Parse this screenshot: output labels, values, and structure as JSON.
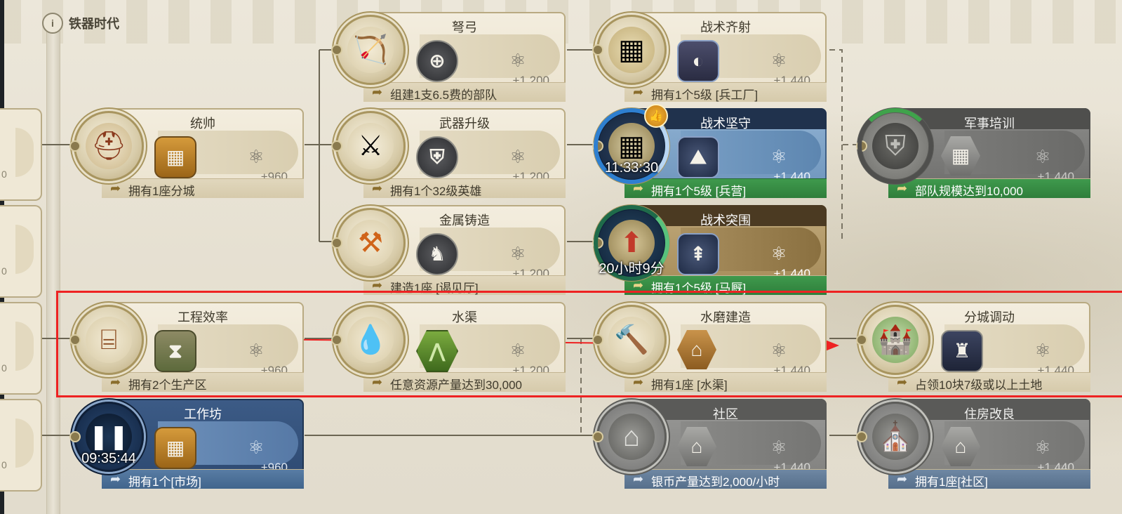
{
  "era": {
    "title": "铁器时代",
    "icon": "info-icon"
  },
  "cards": [
    {
      "id": "crossbow",
      "title": "弩弓",
      "bonus": "helmet-icon",
      "cost": "+1,200",
      "req": "组建1支6.5费的部队",
      "art": "crossbow-icon",
      "state": "normal"
    },
    {
      "id": "volley",
      "title": "战术齐射",
      "bonus": "helmet-icon",
      "cost": "+1,440",
      "req": "拥有1个5级 [兵工厂]",
      "art": "formation-icon",
      "state": "normal"
    },
    {
      "id": "commander",
      "title": "统帅",
      "bonus": "building-icon",
      "cost": "+960",
      "req": "拥有1座分城",
      "art": "helmet-icon",
      "state": "normal"
    },
    {
      "id": "weapon",
      "title": "武器升级",
      "bonus": "shield-icon",
      "cost": "+1,200",
      "req": "拥有1个32级英雄",
      "art": "saber-icon",
      "state": "normal"
    },
    {
      "id": "hold",
      "title": "战术坚守",
      "bonus": "defense-icon",
      "cost": "+1,440",
      "req": "拥有1个5级 [兵营]",
      "art": "formation-icon",
      "state": "researching",
      "timer": "11:33:30"
    },
    {
      "id": "drill",
      "title": "军事培训",
      "bonus": "building-icon",
      "cost": "+1,440",
      "req": "部队规模达到10,000",
      "art": "shield-icon",
      "state": "locked"
    },
    {
      "id": "metal",
      "title": "金属铸造",
      "bonus": "horse-icon",
      "cost": "+1,200",
      "req": "建造1座 [谒见厅]",
      "art": "forge-icon",
      "state": "normal"
    },
    {
      "id": "breakout",
      "title": "战术突围",
      "bonus": "arrow-icon",
      "cost": "+1,440",
      "req": "拥有1个5级 [马厩]",
      "art": "formation-icon",
      "state": "queued",
      "timer": "20小时9分"
    },
    {
      "id": "efficiency",
      "title": "工程效率",
      "bonus": "hourglass-icon",
      "cost": "+960",
      "req": "拥有2个生产区",
      "art": "scaffold-icon",
      "state": "normal"
    },
    {
      "id": "aqueduct",
      "title": "水渠",
      "bonus": "farmland-icon",
      "cost": "+1,200",
      "req": "任意资源产量达到30,000",
      "art": "water-icon",
      "state": "normal"
    },
    {
      "id": "watermill",
      "title": "水磨建造",
      "bonus": "building-icon",
      "cost": "+1,440",
      "req": "拥有1座 [水渠]",
      "art": "hammer-icon",
      "state": "normal"
    },
    {
      "id": "transfer",
      "title": "分城调动",
      "bonus": "castle-icon",
      "cost": "+1,440",
      "req": "占领10块7级或以上土地",
      "art": "castle-icon",
      "state": "normal"
    },
    {
      "id": "workshop",
      "title": "工作坊",
      "bonus": "building-icon",
      "cost": "+960",
      "req": "拥有1个[市场]",
      "art": "pause-icon",
      "state": "paused",
      "timer": "09:35:44"
    },
    {
      "id": "community",
      "title": "社区",
      "bonus": "house-icon",
      "cost": "+1,440",
      "req": "银币产量达到2,000/小时",
      "art": "house-icon",
      "state": "unavailable"
    },
    {
      "id": "housing",
      "title": "住房改良",
      "bonus": "building-icon",
      "cost": "+1,440",
      "req": "拥有1座[社区]",
      "art": "dome-icon",
      "state": "unavailable"
    }
  ],
  "stubs": [
    "0",
    "0",
    "0",
    "0"
  ],
  "colors": {
    "highlight": "#ee2222",
    "research_green": "#3f9a4d",
    "active_blue": "#2c4870"
  }
}
